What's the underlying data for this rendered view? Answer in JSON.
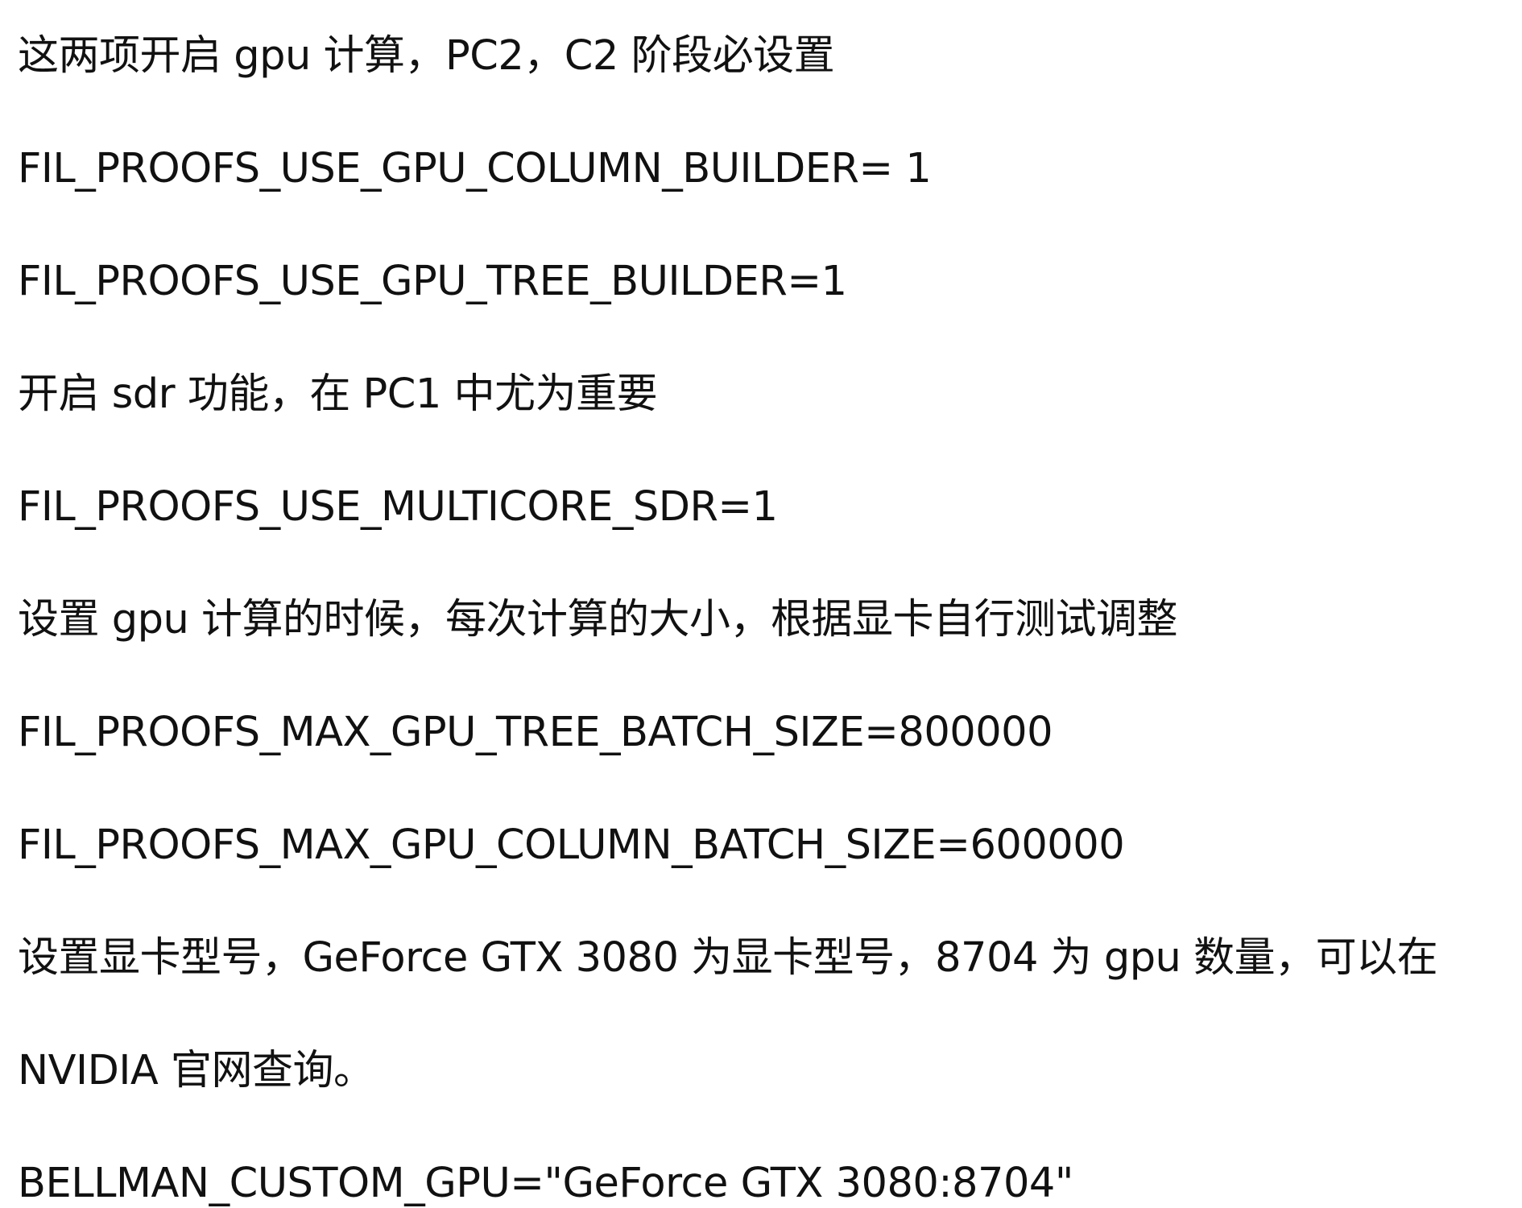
{
  "lines": [
    "这两项开启 gpu 计算，PC2，C2 阶段必设置",
    "FIL_PROOFS_USE_GPU_COLUMN_BUILDER= 1",
    "FIL_PROOFS_USE_GPU_TREE_BUILDER=1",
    "开启 sdr 功能，在 PC1 中尤为重要",
    "FIL_PROOFS_USE_MULTICORE_SDR=1",
    "设置 gpu 计算的时候，每次计算的大小，根据显卡自行测试调整",
    "FIL_PROOFS_MAX_GPU_TREE_BATCH_SIZE=800000",
    "FIL_PROOFS_MAX_GPU_COLUMN_BATCH_SIZE=600000",
    "设置显卡型号，GeForce GTX 3080 为显卡型号，8704 为 gpu 数量，可以在",
    "NVIDIA 官网查询。",
    "BELLMAN_CUSTOM_GPU=\"GeForce GTX 3080:8704\""
  ]
}
